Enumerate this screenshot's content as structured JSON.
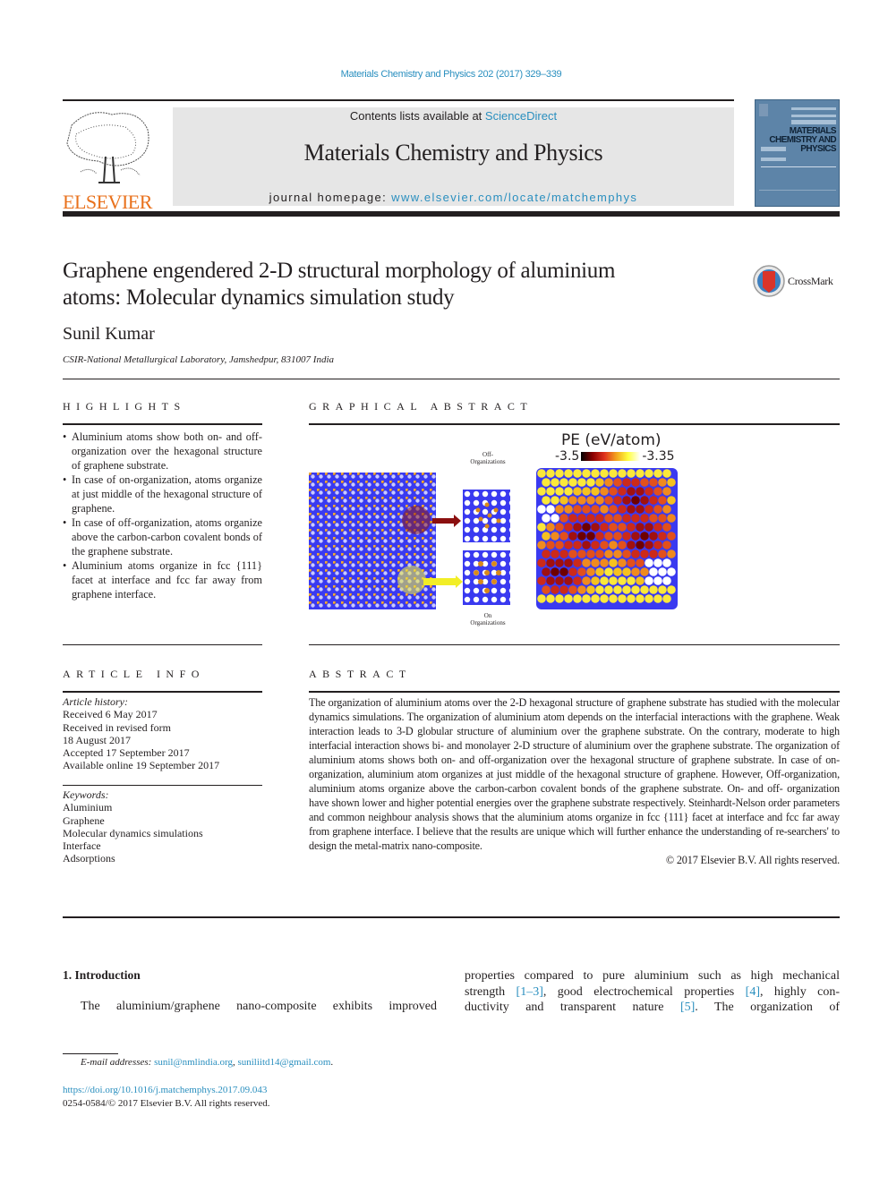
{
  "header": {
    "citation": "Materials Chemistry and Physics 202 (2017) 329–339",
    "contents_prefix": "Contents lists available at ",
    "contents_link": "ScienceDirect",
    "journal_name": "Materials Chemistry and Physics",
    "homepage_prefix": "journal homepage: ",
    "homepage_link": "www.elsevier.com/locate/matchemphys",
    "publisher_logo": "ELSEVIER",
    "cover_title": [
      "MATERIALS",
      "CHEMISTRY AND",
      "PHYSICS"
    ],
    "colors": {
      "link": "#2a8fbf",
      "elsevier_orange": "#e9711c",
      "banner_bg": "#e6e6e6",
      "cover_blue": "#5d84a8"
    }
  },
  "article": {
    "title_line1": "Graphene engendered 2-D structural morphology of aluminium",
    "title_line2": "atoms: Molecular dynamics simulation study",
    "crossmark_label": "CrossMark",
    "author": "Sunil Kumar",
    "affiliation": "CSIR-National Metallurgical Laboratory, Jamshedpur, 831007 India"
  },
  "highlights": {
    "heading": "Highlights",
    "items": [
      "Aluminium atoms show both on- and off-organization over the hexagonal structure of graphene substrate.",
      "In case of on-organization, atoms organize at just middle of the hexagonal structure of graphene.",
      "In case of off-organization, atoms organize above the carbon-carbon covalent bonds of the graphene substrate.",
      "Aluminium atoms organize in fcc {111} facet at interface and fcc far away from graphene interface."
    ]
  },
  "graphical_abstract": {
    "heading": "Graphical abstract",
    "off_label_1": "Off-",
    "off_label_2": "Organizations",
    "on_label_1": "On",
    "on_label_2": "Organizations",
    "colorbar_title": "PE (eV/atom)",
    "colorbar_min": "-3.5",
    "colorbar_max": "-3.35"
  },
  "article_info": {
    "heading": "Article info",
    "history_label": "Article history:",
    "history": [
      "Received 6 May 2017",
      "Received in revised form",
      "18 August 2017",
      "Accepted 17 September 2017",
      "Available online 19 September 2017"
    ],
    "keywords_label": "Keywords:",
    "keywords": [
      "Aluminium",
      "Graphene",
      "Molecular dynamics simulations",
      "Interface",
      "Adsorptions"
    ]
  },
  "abstract": {
    "heading": "Abstract",
    "text": "The organization of aluminium atoms over the 2-D hexagonal structure of graphene substrate has studied with the molecular dynamics simulations. The organization of aluminium atom depends on the interfacial interactions with the graphene. Weak interaction leads to 3-D globular structure of aluminium over the graphene substrate. On the contrary, moderate to high interfacial interaction shows bi- and monolayer 2-D structure of aluminium over the graphene substrate. The organization of aluminium atoms shows both on- and off-organization over the hexagonal structure of graphene substrate. In case of on-organization, aluminium atom organizes at just middle of the hexagonal structure of graphene. However, Off-organization, aluminium atoms organize above the carbon-carbon covalent bonds of the graphene substrate. On- and off- organization have shown lower and higher potential energies over the graphene substrate respectively. Steinhardt-Nelson order parameters and common neighbour analysis shows that the aluminium atoms organize in fcc {111} facet at interface and fcc far away from graphene interface. I believe that the results are unique which will further enhance the understanding of re-searchers' to design the metal-matrix nano-composite.",
    "copyright": "© 2017 Elsevier B.V. All rights reserved."
  },
  "introduction": {
    "heading": "1.  Introduction",
    "left_text": "The aluminium/graphene nano-composite exhibits improved",
    "right_line1": "properties compared to pure aluminium such as high mechanical",
    "right_line2_a": "strength ",
    "ref1": "[1–3]",
    "right_line2_b": ", good electrochemical properties ",
    "ref2": "[4]",
    "right_line2_c": ", highly con-",
    "right_line3_a": "ductivity and transparent nature ",
    "ref3": "[5]",
    "right_line3_b": ". The organization of"
  },
  "footer": {
    "email_label": "E-mail addresses: ",
    "email1": "sunil@nmlindia.org",
    "email2": "suniliitd14@gmail.com",
    "doi": "https://doi.org/10.1016/j.matchemphys.2017.09.043",
    "issn": "0254-0584/© 2017 Elsevier B.V. All rights reserved."
  }
}
